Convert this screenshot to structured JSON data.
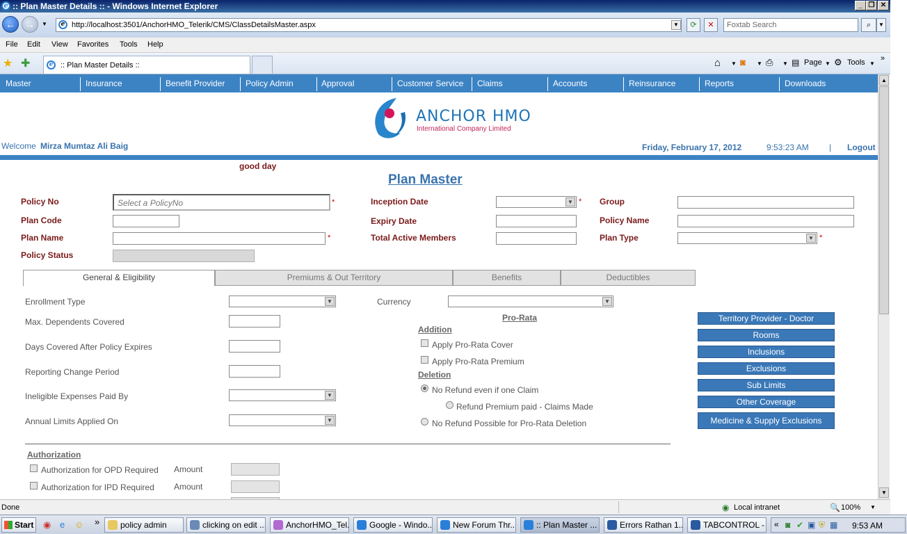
{
  "window": {
    "title": ":: Plan Master Details :: - Windows Internet Explorer"
  },
  "browser": {
    "url": "http://localhost:3501/AnchorHMO_Telerik/CMS/ClassDetailsMaster.aspx",
    "search_placeholder": "Foxtab Search",
    "menu": [
      "File",
      "Edit",
      "View",
      "Favorites",
      "Tools",
      "Help"
    ],
    "tab_title": ":: Plan Master Details ::",
    "page_label": "Page",
    "tools_label": "Tools"
  },
  "site_nav": [
    "Master",
    "Insurance",
    "Benefit Provider",
    "Policy Admin",
    "Approval",
    "Customer Service",
    "Claims",
    "Accounts",
    "Reinsurance",
    "Reports",
    "Downloads"
  ],
  "logo": {
    "name": "ANCHOR HMO",
    "sub": "International Company Limited"
  },
  "header": {
    "welcome": "Welcome",
    "user": "Mirza Mumtaz Ali Baig",
    "date": "Friday, February 17, 2012",
    "time": "9:53:23 AM",
    "sep": "|",
    "logout": "Logout",
    "greeting": "good day"
  },
  "page_title": "Plan Master",
  "form": {
    "policy_no": "Policy No",
    "policy_no_placeholder": "Select a PolicyNo",
    "plan_code": "Plan Code",
    "plan_name": "Plan Name",
    "policy_status": "Policy Status",
    "inception_date": "Inception Date",
    "expiry_date": "Expiry Date",
    "total_active_members": "Total Active Members",
    "group": "Group",
    "policy_name": "Policy Name",
    "plan_type": "Plan Type",
    "required_mark": "*"
  },
  "tabs": [
    "General & Eligibility",
    "Premiums & Out Territory",
    "Benefits",
    "Deductibles"
  ],
  "general": {
    "enrollment_type": "Enrollment Type",
    "max_dependents": "Max. Dependents Covered",
    "days_covered": "Days Covered After Policy Expires",
    "reporting_change": "Reporting Change Period",
    "ineligible_expenses": "Ineligible Expenses Paid By",
    "annual_limits": "Annual Limits Applied On",
    "currency": "Currency",
    "pro_rata": "Pro-Rata",
    "addition": "Addition",
    "apply_cover": "Apply Pro-Rata Cover",
    "apply_premium": "Apply Pro-Rata Premium",
    "deletion": "Deletion",
    "no_refund_claim": "No Refund even if one Claim",
    "refund_premium": "Refund Premium paid - Claims Made",
    "no_refund_possible": "No Refund Possible for Pro-Rata Deletion",
    "authorization": "Authorization",
    "auth_opd": "Authorization for OPD Required",
    "auth_ipd": "Authorization for IPD Required",
    "amount": "Amount"
  },
  "side_buttons": [
    "Territory Provider - Doctor",
    "Rooms",
    "Inclusions",
    "Exclusions",
    "Sub Limits",
    "Other Coverage",
    "Medicine & Supply Exclusions"
  ],
  "status": {
    "text": "Done",
    "zone": "Local intranet",
    "zoom": "100%"
  },
  "taskbar": {
    "start": "Start",
    "items": [
      "policy admin",
      "clicking on edit ...",
      "AnchorHMO_Tel...",
      "Google - Windo...",
      "New Forum Thr...",
      ":: Plan Master ...",
      "Errors Rathan 1...",
      "TABCONTROL - ..."
    ],
    "clock": "9:53 AM"
  }
}
